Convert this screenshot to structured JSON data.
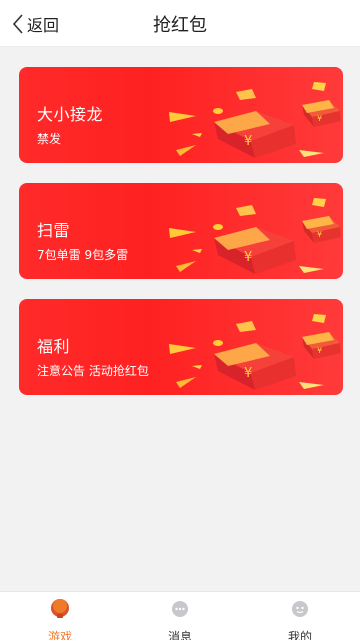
{
  "header": {
    "back_label": "返回",
    "title": "抢红包"
  },
  "cards": [
    {
      "title": "大小接龙",
      "subtitle": "禁发"
    },
    {
      "title": "扫雷",
      "subtitle": "7包单雷 9包多雷"
    },
    {
      "title": "福利",
      "subtitle": "注意公告 活动抢红包"
    }
  ],
  "tabbar": {
    "items": [
      {
        "label": "游戏",
        "icon": "game-icon",
        "active": true
      },
      {
        "label": "消息",
        "icon": "message-icon",
        "active": false
      },
      {
        "label": "我的",
        "icon": "profile-icon",
        "active": false
      }
    ],
    "active_color": "#f07a2a"
  },
  "colors": {
    "card_red": "#ff2424",
    "envelope_gold": "#ffd23a"
  }
}
